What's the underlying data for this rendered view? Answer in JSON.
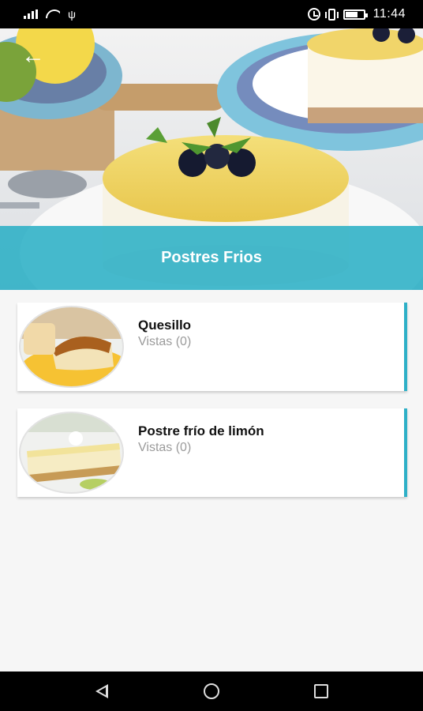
{
  "status_bar": {
    "time": "11:44",
    "icons": [
      "signal-icon",
      "wifi-icon",
      "usb-icon",
      "alarm-icon",
      "vibrate-icon",
      "battery-icon"
    ]
  },
  "header": {
    "title": "Postres Frios",
    "back_icon": "arrow-left-icon",
    "band_color": "#26aec4"
  },
  "recipes": [
    {
      "title": "Quesillo",
      "views": "Vistas (0)",
      "image": "flan-dessert"
    },
    {
      "title": "Postre frío de limón",
      "views": "Vistas (0)",
      "image": "lemon-cheesecake-slice"
    }
  ],
  "nav": {
    "icons": [
      "back-triangle-icon",
      "home-circle-icon",
      "recent-apps-square-icon"
    ]
  },
  "colors": {
    "accent": "#2eb0c7",
    "secondary_text": "#9b9b9b"
  }
}
